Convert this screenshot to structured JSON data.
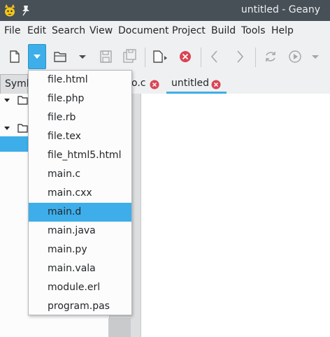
{
  "window": {
    "title": "untitled - Geany"
  },
  "menubar": [
    "File",
    "Edit",
    "Search",
    "View",
    "Document",
    "Project",
    "Build",
    "Tools",
    "Help"
  ],
  "sidebar": {
    "tab_label": "Symb"
  },
  "tabs": [
    {
      "label": "o.c",
      "closable": true
    },
    {
      "label": "untitled",
      "closable": true,
      "active": true
    }
  ],
  "new_from_template_menu": {
    "items": [
      "file.html",
      "file.php",
      "file.rb",
      "file.tex",
      "file_html5.html",
      "main.c",
      "main.cxx",
      "main.d",
      "main.java",
      "main.py",
      "main.vala",
      "module.erl",
      "program.pas"
    ],
    "selected": "main.d"
  },
  "colors": {
    "accent": "#3daee9",
    "titlebar": "#475057",
    "close_red": "#da4453"
  }
}
